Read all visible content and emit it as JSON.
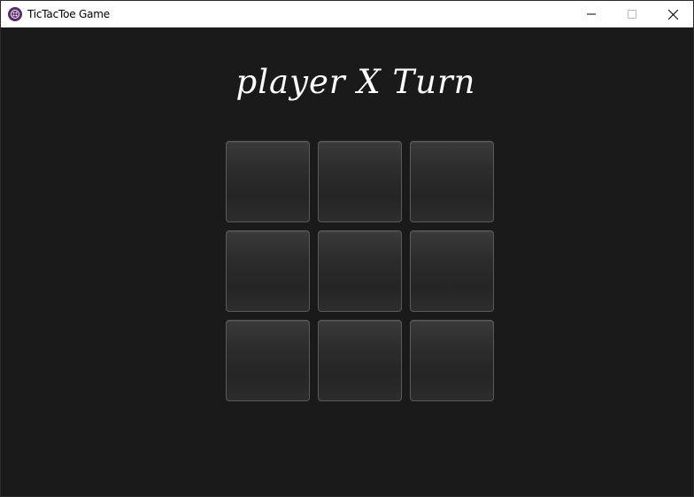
{
  "window": {
    "title": "TicTacToe Game",
    "icon": "game-app-icon",
    "controls": [
      "minimize-icon",
      "maximize-icon",
      "close-icon"
    ]
  },
  "game": {
    "turn_label": "player X Turn",
    "board": [
      "",
      "",
      "",
      "",
      "",
      "",
      "",
      "",
      ""
    ]
  },
  "colors": {
    "background": "#1a1a1a",
    "titlebar": "#ffffff",
    "cell_border": "#5a5a5a",
    "text": "#ffffff",
    "app_icon": "#5a2a6e"
  }
}
